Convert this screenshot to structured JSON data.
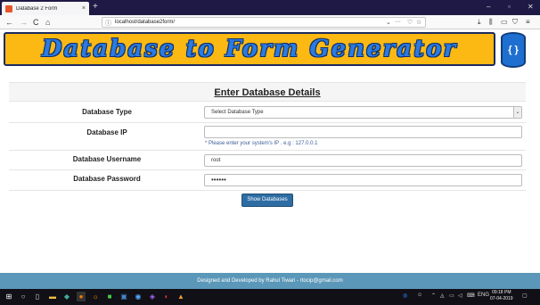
{
  "browser": {
    "tab_title": "Database 2 Form",
    "tab_close": "×",
    "new_tab": "+",
    "window_controls": {
      "minimize": "–",
      "maximize": "▫",
      "close": "✕"
    },
    "url": "localhost/database2form/",
    "url_menu": "···",
    "nav": {
      "back": "←",
      "forward": "→",
      "reload": "C",
      "home": "⌂"
    }
  },
  "banner": {
    "title": "Database to Form Generator",
    "logo_glyph": "{ }"
  },
  "form": {
    "title": "Enter Database Details",
    "rows": [
      {
        "label": "Database Type",
        "value": "Select Database Type"
      },
      {
        "label": "Database IP",
        "value": "",
        "hint": "* Please enter your system's IP . e.g : 127.0.0.1"
      },
      {
        "label": "Database Username",
        "value": "root"
      },
      {
        "label": "Database Password",
        "value": "••••••"
      }
    ],
    "submit_label": "Show Databases"
  },
  "footer": {
    "text": "Designed and Developed by Rahul Tiwari - rtocip@gmail.com"
  },
  "taskbar": {
    "language": "ENG",
    "time": "09:18 PM",
    "date": "07-04-2019"
  },
  "colors": {
    "banner_bg": "#fdb913",
    "banner_text": "#2b7be0",
    "button": "#2e6da4",
    "footer": "#5b97b8",
    "tabbar": "#1f1a45"
  }
}
